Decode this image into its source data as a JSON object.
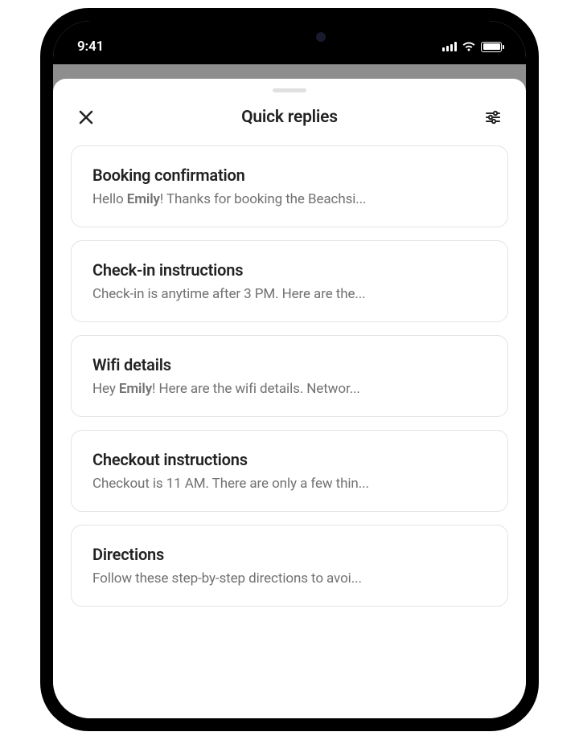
{
  "statusBar": {
    "time": "9:41"
  },
  "header": {
    "title": "Quick replies"
  },
  "replies": [
    {
      "title": "Booking confirmation",
      "previewPrefix": "Hello ",
      "previewBold": "Emily",
      "previewSuffix": "! Thanks for booking the Beachsi..."
    },
    {
      "title": "Check-in instructions",
      "previewPrefix": "Check-in is anytime after 3 PM. Here are the...",
      "previewBold": "",
      "previewSuffix": ""
    },
    {
      "title": "Wifi details",
      "previewPrefix": "Hey ",
      "previewBold": "Emily",
      "previewSuffix": "! Here are the wifi details. Networ..."
    },
    {
      "title": "Checkout instructions",
      "previewPrefix": "Checkout is 11 AM. There are only a few thin...",
      "previewBold": "",
      "previewSuffix": ""
    },
    {
      "title": "Directions",
      "previewPrefix": "Follow these step-by-step directions to avoi...",
      "previewBold": "",
      "previewSuffix": ""
    }
  ]
}
